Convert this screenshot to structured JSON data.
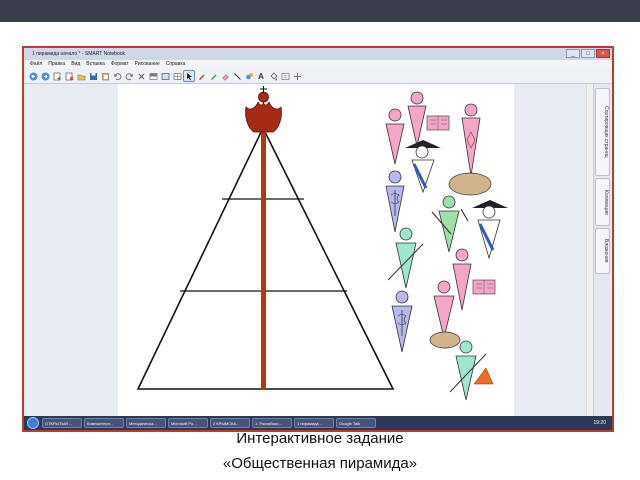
{
  "window": {
    "title": "1 пирамида начало * - SMART Notebook",
    "buttons": [
      "_",
      "□",
      "×"
    ]
  },
  "menu": [
    "Файл",
    "Правка",
    "Вид",
    "Вставка",
    "Формат",
    "Рисование",
    "Справка"
  ],
  "toolbar_icons": [
    "back-icon",
    "forward-icon",
    "add-page-icon",
    "delete-page-icon",
    "open-icon",
    "save-icon",
    "paste-icon",
    "undo-icon",
    "redo-icon",
    "delete-icon",
    "screen-shade-icon",
    "fullscreen-icon",
    "table-icon",
    "select-icon",
    "pen-icon",
    "creative-pen-icon",
    "eraser-icon",
    "line-icon",
    "shape-icon",
    "text-icon",
    "fill-icon",
    "properties-icon",
    "move-toolbar-icon"
  ],
  "side_tabs": [
    "Сортировщик страниц",
    "Коллекция",
    "Вложения"
  ],
  "taskbar": {
    "items": [
      "ОТКРЫТЫЙ ...",
      "Компьютерн...",
      "Методическа...",
      "Microsoft Po...",
      "2 КРЫМСКА...",
      "1. Российско...",
      "1 пирамида ...",
      "Google Talk"
    ],
    "clock": "19:20"
  },
  "caption": {
    "line1": "Интерактивное задание",
    "line2": "«Общественная пирамида»"
  },
  "colors": {
    "topbar": "#3a3d4a",
    "frame_border": "#c0392b",
    "pole": "#b5360f",
    "crown": "#a52a16"
  }
}
